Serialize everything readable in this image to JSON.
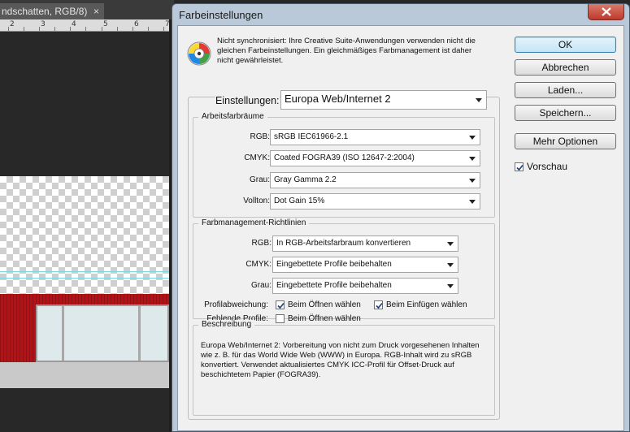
{
  "background": {
    "doc_tab_label": "ndschatten, RGB/8)",
    "doc_tab_close": "×",
    "ruler_labels": [
      "2",
      "3",
      "4",
      "5",
      "6",
      "7"
    ]
  },
  "dialog": {
    "title": "Farbeinstellungen",
    "info_text": "Nicht synchronisiert: Ihre Creative Suite-Anwendungen verwenden nicht die gleichen Farbeinstellungen. Ein gleichmäßiges Farbmanagement ist daher nicht gewährleistet.",
    "settings_label": "Einstellungen:",
    "settings_value": "Europa Web/Internet 2",
    "workspaces": {
      "title": "Arbeitsfarbräume",
      "rgb_label": "RGB:",
      "rgb_value": "sRGB IEC61966-2.1",
      "cmyk_label": "CMYK:",
      "cmyk_value": "Coated FOGRA39 (ISO 12647-2:2004)",
      "gray_label": "Grau:",
      "gray_value": "Gray Gamma 2.2",
      "spot_label": "Vollton:",
      "spot_value": "Dot Gain 15%"
    },
    "policies": {
      "title": "Farbmanagement-Richtlinien",
      "rgb_label": "RGB:",
      "rgb_value": "In RGB-Arbeitsfarbraum konvertieren",
      "cmyk_label": "CMYK:",
      "cmyk_value": "Eingebettete Profile beibehalten",
      "gray_label": "Grau:",
      "gray_value": "Eingebettete Profile beibehalten",
      "mismatch_label": "Profilabweichung:",
      "mismatch_open": "Beim Öffnen wählen",
      "mismatch_paste": "Beim Einfügen wählen",
      "missing_label": "Fehlende Profile:",
      "missing_open": "Beim Öffnen wählen"
    },
    "description": {
      "title": "Beschreibung",
      "text": "Europa Web/Internet 2:  Vorbereitung von nicht zum Druck vorgesehenen Inhalten wie z. B. für das World Wide Web (WWW) in Europa. RGB-Inhalt wird zu sRGB konvertiert. Verwendet aktualisiertes CMYK ICC-Profil für Offset-Druck auf beschichtetem Papier (FOGRA39)."
    },
    "buttons": {
      "ok": "OK",
      "cancel": "Abbrechen",
      "load": "Laden...",
      "save": "Speichern...",
      "more": "Mehr Optionen"
    },
    "preview_label": "Vorschau",
    "checkboxes": {
      "preview": true,
      "mismatch_open": true,
      "mismatch_paste": true,
      "missing_open": false
    }
  }
}
